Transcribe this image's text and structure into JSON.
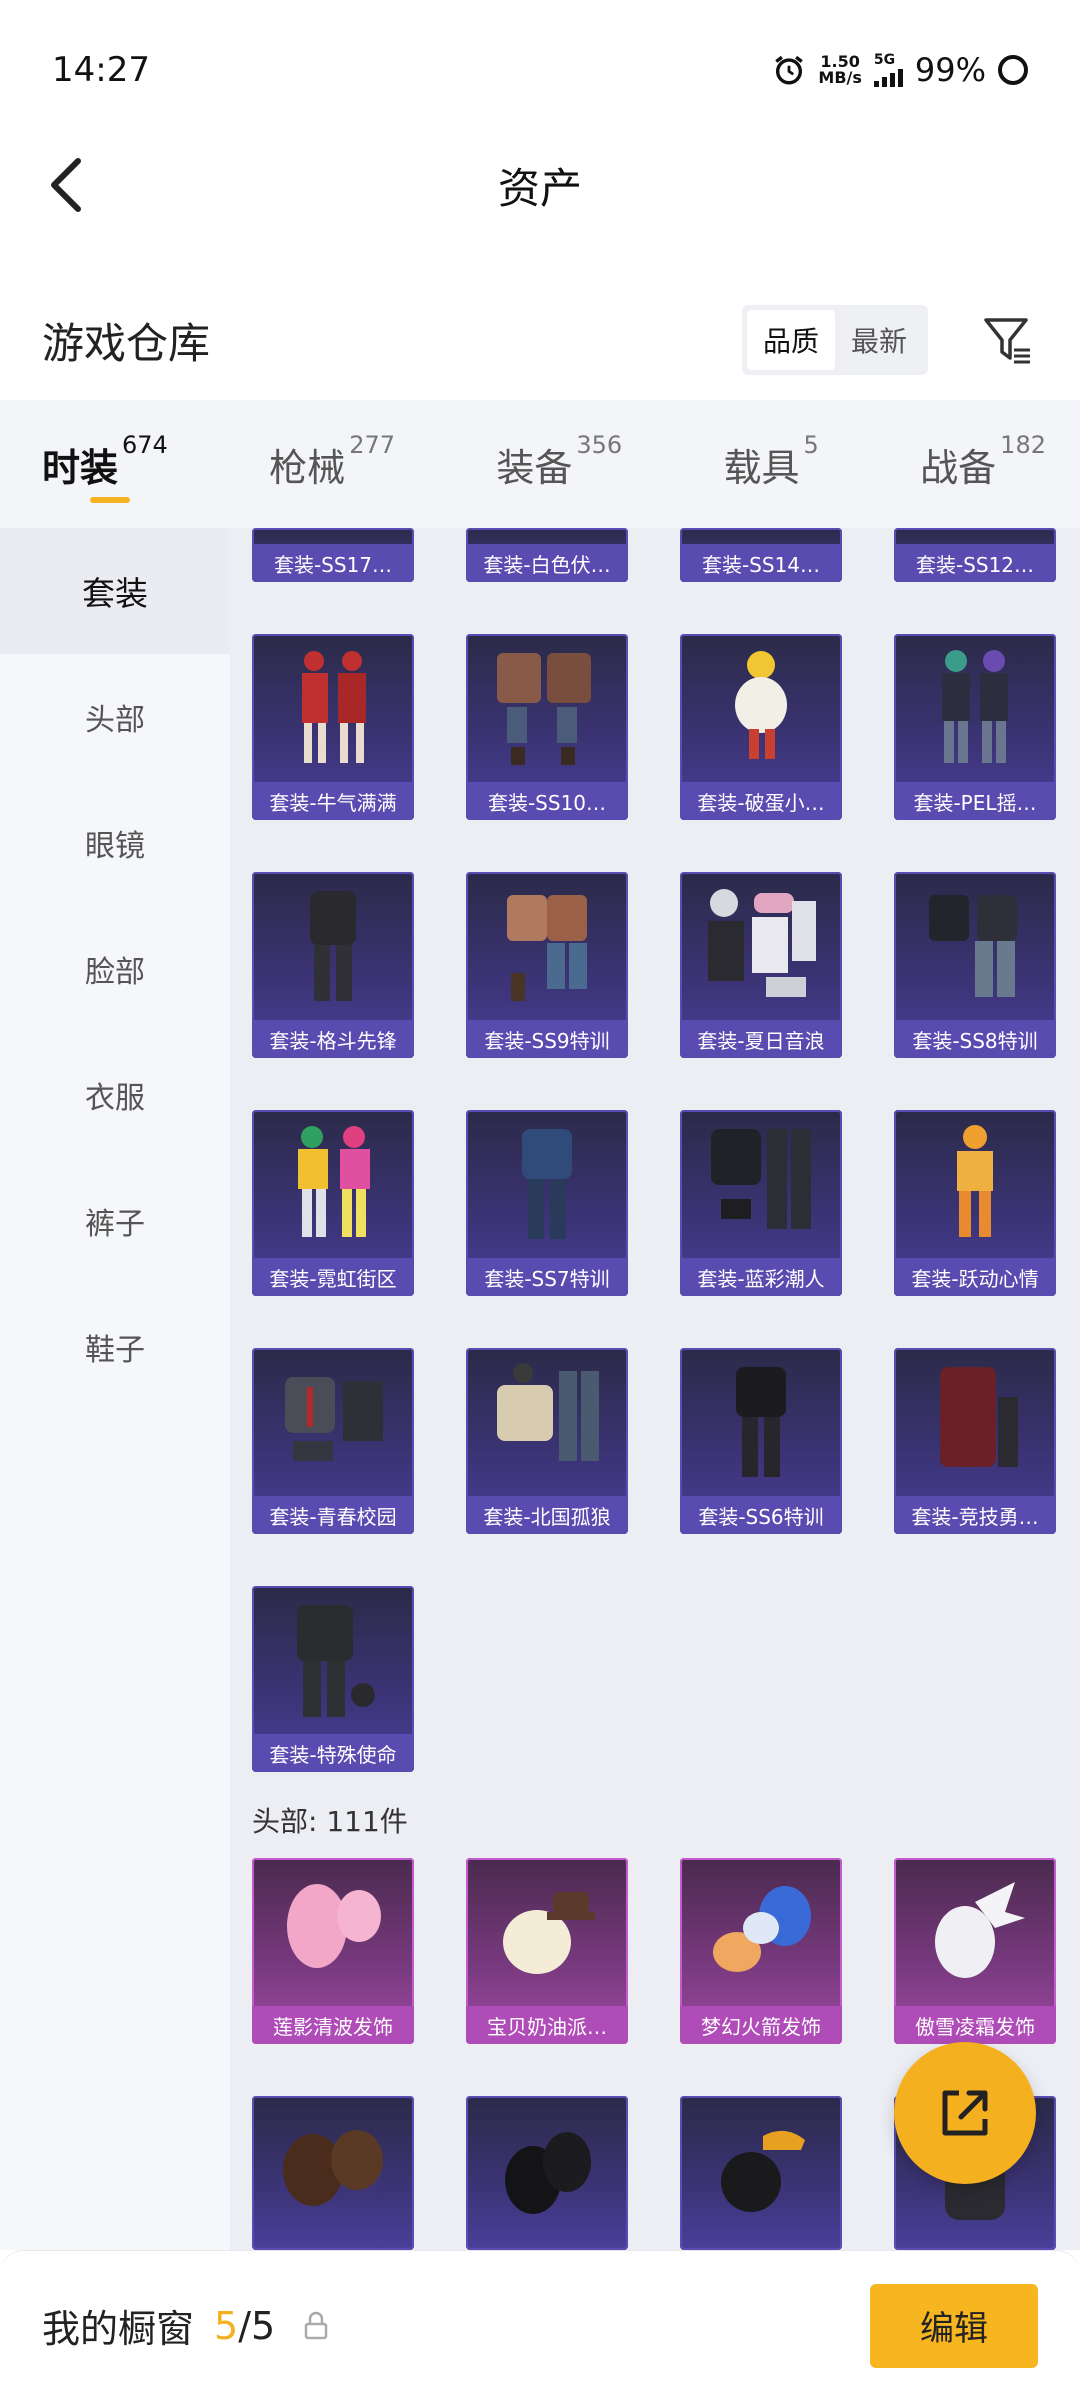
{
  "status": {
    "time": "14:27",
    "net_speed_value": "1.50",
    "net_speed_unit": "MB/s",
    "net_type": "5G",
    "battery": "99%"
  },
  "header": {
    "title": "资产"
  },
  "warehouse": {
    "title": "游戏仓库",
    "sort_options": [
      "品质",
      "最新"
    ],
    "active_sort": "品质"
  },
  "tabs": [
    {
      "label": "时装",
      "count": "674"
    },
    {
      "label": "枪械",
      "count": "277"
    },
    {
      "label": "装备",
      "count": "356"
    },
    {
      "label": "载具",
      "count": "5"
    },
    {
      "label": "战备",
      "count": "182"
    }
  ],
  "sidebar": {
    "items": [
      "套装",
      "头部",
      "眼镜",
      "脸部",
      "衣服",
      "裤子",
      "鞋子"
    ]
  },
  "suits": {
    "row0": [
      "套装-SS17…",
      "套装-白色伏…",
      "套装-SS14…",
      "套装-SS12…"
    ],
    "row1": [
      "套装-牛气满满",
      "套装-SS10…",
      "套装-破蛋小…",
      "套装-PEL摇…"
    ],
    "row2": [
      "套装-格斗先锋",
      "套装-SS9特训",
      "套装-夏日音浪",
      "套装-SS8特训"
    ],
    "row3": [
      "套装-霓虹街区",
      "套装-SS7特训",
      "套装-蓝彩潮人",
      "套装-跃动心情"
    ],
    "row4": [
      "套装-青春校园",
      "套装-北国孤狼",
      "套装-SS6特训",
      "套装-竞技勇…"
    ],
    "row5": [
      "套装-特殊使命"
    ]
  },
  "head_section": {
    "title": "头部: 111件",
    "row1": [
      "莲影清波发饰",
      "宝贝奶油派…",
      "梦幻火箭发饰",
      "傲雪凌霜发饰"
    ]
  },
  "bottom": {
    "showcase_label": "我的橱窗",
    "current": "5",
    "slash_total": "/5",
    "edit_label": "编辑"
  },
  "colors": {
    "accent": "#f5b020",
    "card_purple": "#5a4bb0",
    "card_pink": "#b04cb8"
  }
}
